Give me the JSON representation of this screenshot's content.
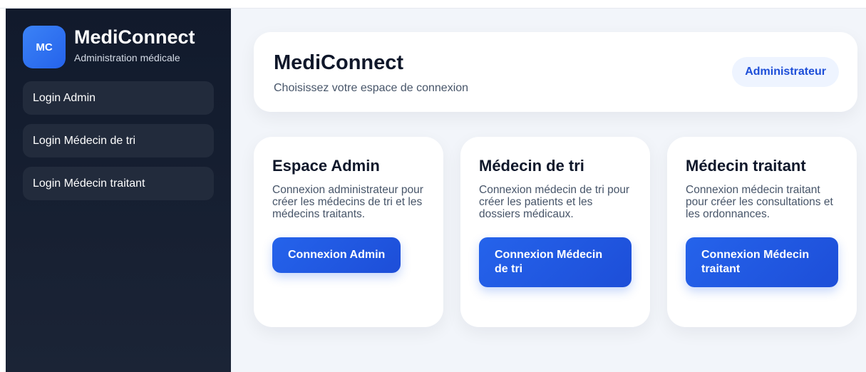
{
  "brand": {
    "logo_text": "MC",
    "title": "MediConnect",
    "subtitle": "Administration médicale"
  },
  "sidebar": {
    "items": [
      {
        "label": "Login Admin"
      },
      {
        "label": "Login Médecin de tri"
      },
      {
        "label": "Login Médecin traitant"
      }
    ]
  },
  "header": {
    "title": "MediConnect",
    "subtitle": "Choisissez votre espace de connexion",
    "role_badge": "Administrateur"
  },
  "cards": [
    {
      "title": "Espace Admin",
      "description": "Connexion administrateur pour créer les médecins de tri et les médecins traitants.",
      "button": "Connexion Admin"
    },
    {
      "title": "Médecin de tri",
      "description": "Connexion médecin de tri pour créer les patients et les dossiers médicaux.",
      "button": "Connexion Médecin de tri"
    },
    {
      "title": "Médecin traitant",
      "description": "Connexion médecin traitant pour créer les consultations et les ordonnances.",
      "button": "Connexion Médecin traitant"
    }
  ],
  "colors": {
    "sidebar_bg": "#111a2c",
    "accent": "#2563eb",
    "main_bg": "#f2f5fa"
  }
}
